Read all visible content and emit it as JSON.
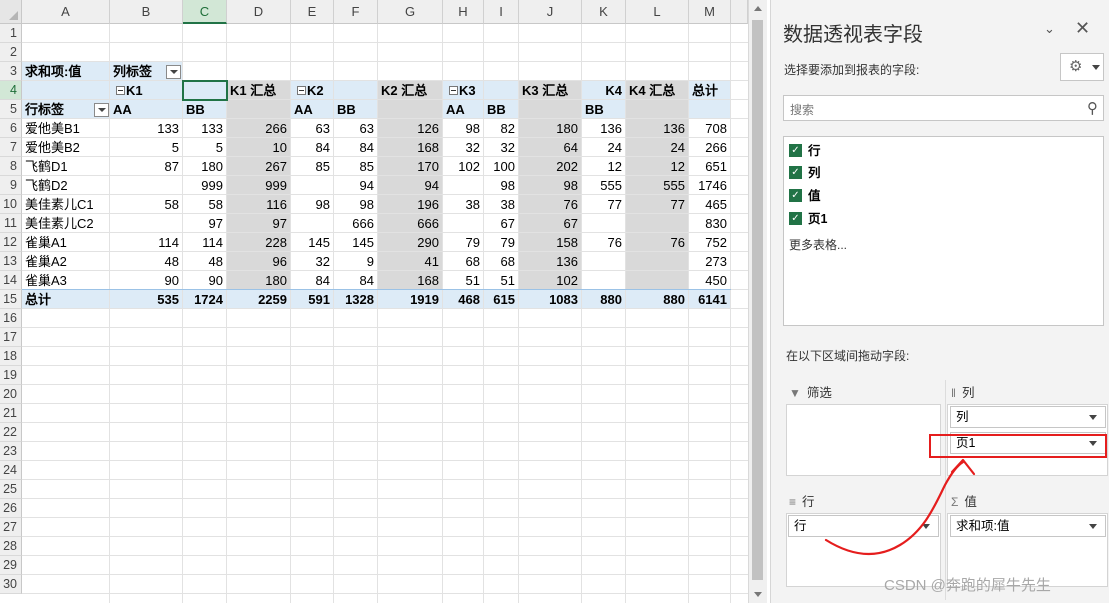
{
  "sheet": {
    "columns": [
      "A",
      "B",
      "C",
      "D",
      "E",
      "F",
      "G",
      "H",
      "I",
      "J",
      "K",
      "L",
      "M"
    ],
    "rows": [
      "1",
      "2",
      "3",
      "4",
      "5",
      "6",
      "7",
      "8",
      "9",
      "10",
      "11",
      "12",
      "13",
      "14",
      "15",
      "16",
      "17",
      "18",
      "19",
      "20",
      "21",
      "22",
      "23",
      "24",
      "25",
      "26",
      "27",
      "28",
      "29",
      "30"
    ],
    "selected_cell": "C4"
  },
  "pivot": {
    "value_label": "求和项:值",
    "column_label": "列标签",
    "row_label": "行标签",
    "groups": [
      {
        "name": "K1",
        "total": "K1 汇总"
      },
      {
        "name": "K2",
        "total": "K2 汇总"
      },
      {
        "name": "K3",
        "total": "K3 汇总"
      },
      {
        "name": "K4",
        "total": "K4 汇总"
      }
    ],
    "grand_total_label": "总计",
    "subheaders": [
      "AA",
      "BB",
      "AA",
      "BB",
      "AA",
      "BB",
      "BB"
    ],
    "rows": [
      {
        "label": "爱他美B1",
        "values": [
          "133",
          "133",
          "266",
          "63",
          "63",
          "126",
          "98",
          "82",
          "180",
          "136",
          "136",
          "708"
        ]
      },
      {
        "label": "爱他美B2",
        "values": [
          "5",
          "5",
          "10",
          "84",
          "84",
          "168",
          "32",
          "32",
          "64",
          "24",
          "24",
          "266"
        ]
      },
      {
        "label": "飞鹤D1",
        "values": [
          "87",
          "180",
          "267",
          "85",
          "85",
          "170",
          "102",
          "100",
          "202",
          "12",
          "12",
          "651"
        ]
      },
      {
        "label": "飞鹤D2",
        "values": [
          "",
          "999",
          "999",
          "",
          "94",
          "94",
          "",
          "98",
          "98",
          "555",
          "555",
          "1746"
        ]
      },
      {
        "label": "美佳素儿C1",
        "values": [
          "58",
          "58",
          "116",
          "98",
          "98",
          "196",
          "38",
          "38",
          "76",
          "77",
          "77",
          "465"
        ]
      },
      {
        "label": "美佳素儿C2",
        "values": [
          "",
          "97",
          "97",
          "",
          "666",
          "666",
          "",
          "67",
          "67",
          "",
          "",
          "830"
        ]
      },
      {
        "label": "雀巢A1",
        "values": [
          "114",
          "114",
          "228",
          "145",
          "145",
          "290",
          "79",
          "79",
          "158",
          "76",
          "76",
          "752"
        ]
      },
      {
        "label": "雀巢A2",
        "values": [
          "48",
          "48",
          "96",
          "32",
          "9",
          "41",
          "68",
          "68",
          "136",
          "",
          "",
          "273"
        ]
      },
      {
        "label": "雀巢A3",
        "values": [
          "90",
          "90",
          "180",
          "84",
          "84",
          "168",
          "51",
          "51",
          "102",
          "",
          "",
          "450"
        ]
      }
    ],
    "total_row": {
      "label": "总计",
      "values": [
        "535",
        "1724",
        "2259",
        "591",
        "1328",
        "1919",
        "468",
        "615",
        "1083",
        "880",
        "880",
        "6141"
      ]
    }
  },
  "pane": {
    "title": "数据透视表字段",
    "subtitle": "选择要添加到报表的字段:",
    "search_placeholder": "搜索",
    "fields": [
      "行",
      "列",
      "值",
      "页1"
    ],
    "more_tables": "更多表格...",
    "drag_hint": "在以下区域间拖动字段:",
    "areas": {
      "filter": "筛选",
      "columns": "列",
      "rows": "行",
      "values": "值"
    },
    "column_chips": [
      "列",
      "页1"
    ],
    "row_chips": [
      "行"
    ],
    "value_chips": [
      "求和项:值"
    ]
  },
  "watermark": "CSDN @奔跑的犀牛先生"
}
